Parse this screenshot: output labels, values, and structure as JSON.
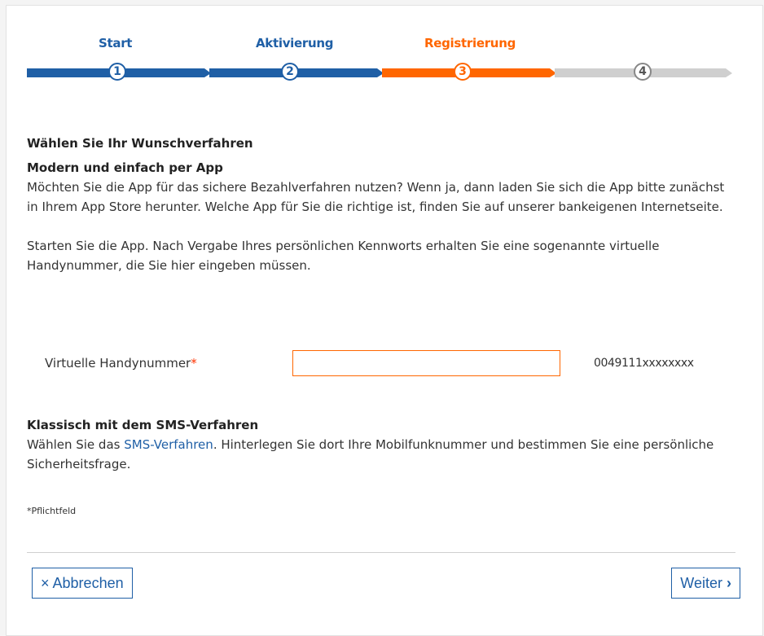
{
  "steps": [
    {
      "label": "Start",
      "number": "1",
      "state": "done"
    },
    {
      "label": "Aktivierung",
      "number": "2",
      "state": "done"
    },
    {
      "label": "Registrierung",
      "number": "3",
      "state": "active"
    },
    {
      "label": "",
      "number": "4",
      "state": "pending"
    }
  ],
  "colors": {
    "primary": "#1f5fa6",
    "active": "#ff6600",
    "pending": "#cfcfcf"
  },
  "content": {
    "heading": "Wählen Sie Ihr Wunschverfahren",
    "app_title": "Modern und einfach per App",
    "app_text": "Möchten Sie die App für das sichere Bezahlverfahren nutzen? Wenn ja, dann laden Sie sich die App bitte zunächst in Ihrem App Store herunter. Welche App für Sie die richtige ist, finden Sie auf unserer bankeigenen Internetseite.",
    "app_text2": "Starten Sie die App. Nach Vergabe Ihres persönlichen Kennworts erhalten Sie eine sogenannte virtuelle Handynummer, die Sie hier eingeben müssen."
  },
  "field": {
    "label": "Virtuelle Handynummer",
    "required_mark": "*",
    "value": "",
    "hint": "0049111xxxxxxxx"
  },
  "sms": {
    "title": "Klassisch mit dem SMS-Verfahren",
    "text_before": "Wählen Sie das ",
    "link": "SMS-Verfahren",
    "text_after": ". Hinterlegen Sie dort Ihre Mobilfunknummer und bestimmen Sie eine persönliche Sicherheitsfrage."
  },
  "required_note": "*Pflichtfeld",
  "buttons": {
    "cancel_icon": "×",
    "cancel_label": "Abbrechen",
    "next_label": "Weiter",
    "next_icon": "›"
  }
}
